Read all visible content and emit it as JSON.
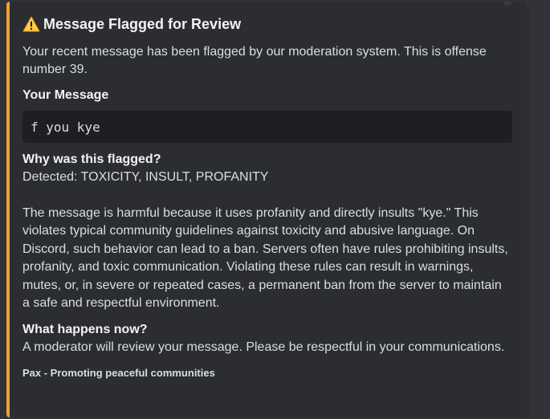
{
  "embed": {
    "accent_color": "#f0a232",
    "icon": "warning-icon",
    "title": "Message Flagged for Review",
    "description": "Your recent message has been flagged by our moderation system. This is offense number 39.",
    "your_message": {
      "label": "Your Message",
      "content": "f you kye"
    },
    "why": {
      "label": "Why was this flagged?",
      "detected": "Detected: TOXICITY, INSULT, PROFANITY",
      "explanation": "The message is harmful because it uses profanity and directly insults \"kye.\" This violates typical community guidelines against toxicity and abusive language. On Discord, such behavior can lead to a ban. Servers often have rules prohibiting insults, profanity, and toxic communication. Violating these rules can result in warnings, mutes, or, in severe or repeated cases, a permanent ban from the server to maintain a safe and respectful environment."
    },
    "next": {
      "label": "What happens now?",
      "text": "A moderator will review your message. Please be respectful in your communications."
    },
    "footer": "Pax - Promoting peaceful communities"
  }
}
